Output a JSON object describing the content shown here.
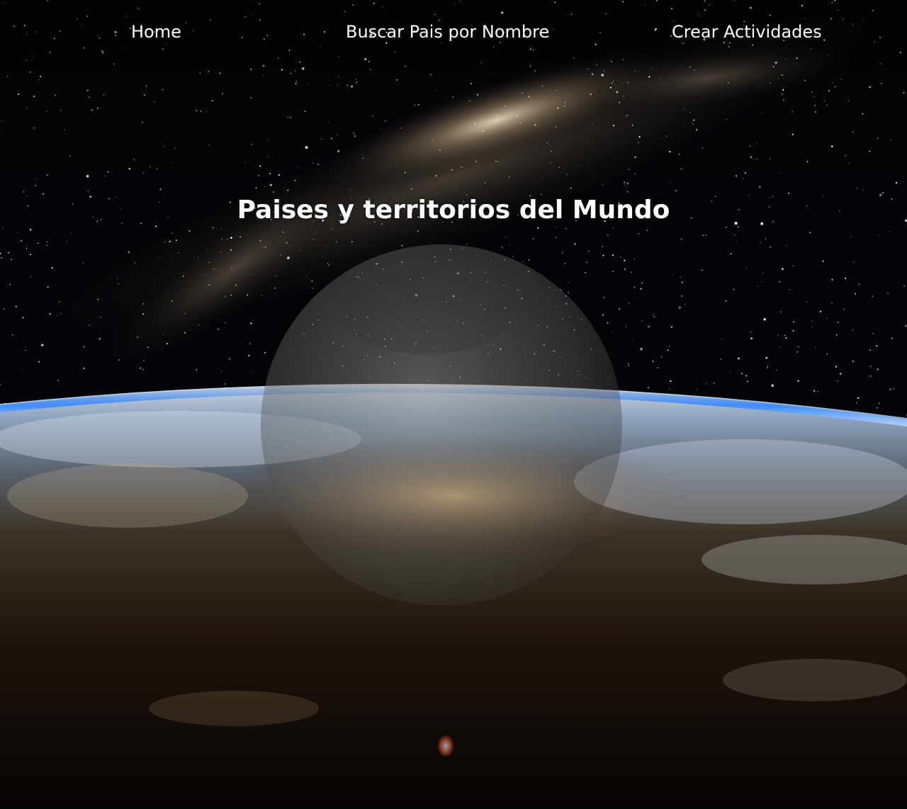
{
  "nav": {
    "home_label": "Home",
    "search_label": "Buscar Pais por Nombre",
    "create_label": "Crear Actividades"
  },
  "hero": {
    "title": "Paises y territorios del Mundo"
  },
  "colors": {
    "text": "#ffffff",
    "space": "#020204",
    "atmosphere": "#2a7fff"
  }
}
